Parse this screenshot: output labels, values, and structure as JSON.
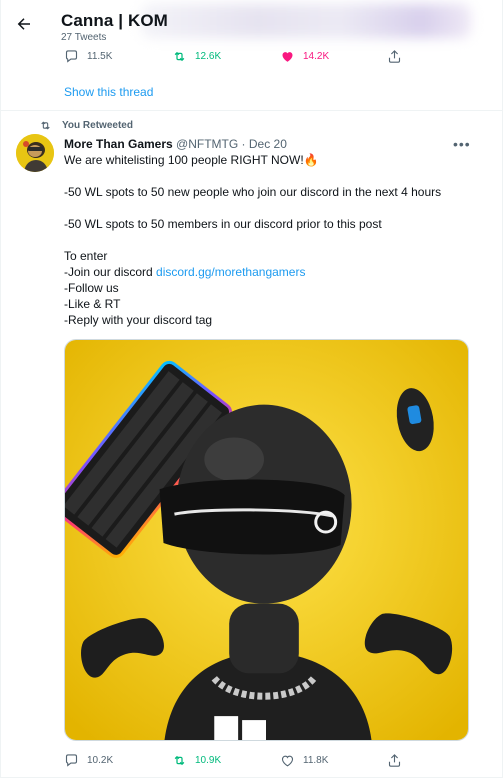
{
  "header": {
    "title": "Canna | KOM",
    "tweet_count": "27 Tweets"
  },
  "prev_tweet": {
    "reply_count": "11.5K",
    "retweet_count": "12.6K",
    "like_count": "14.2K",
    "show_thread": "Show this thread"
  },
  "retweet_banner": "You Retweeted",
  "tweet": {
    "author_name": "More Than Gamers",
    "handle_and_date": "@NFTMTG · Dec 20",
    "line1": "We are whitelisting 100 people RIGHT NOW!🔥",
    "line2": "-50 WL spots to 50 new people who join our discord in the next 4 hours",
    "line3": "-50 WL spots to 50 members in our discord prior to this post",
    "line4": "To enter",
    "line5_prefix": "-Join our discord ",
    "line5_link": "discord.gg/morethangamers",
    "line6": "-Follow us",
    "line7": "-Like & RT",
    "line8": "-Reply with your discord tag",
    "reply_count": "10.2K",
    "retweet_count": "10.9K",
    "like_count": "11.8K"
  },
  "colors": {
    "accent_blue": "#1d9bf0",
    "retweet_green": "#00ba7c",
    "like_pink": "#f91880",
    "muted_gray": "#536471",
    "media_yellow": "#f1c40f"
  },
  "icons": {
    "back": "arrow-left-icon",
    "reply": "speech-bubble-icon",
    "retweet": "retweet-arrows-icon",
    "like": "heart-icon",
    "share": "share-upload-icon",
    "more": "ellipsis-icon"
  }
}
